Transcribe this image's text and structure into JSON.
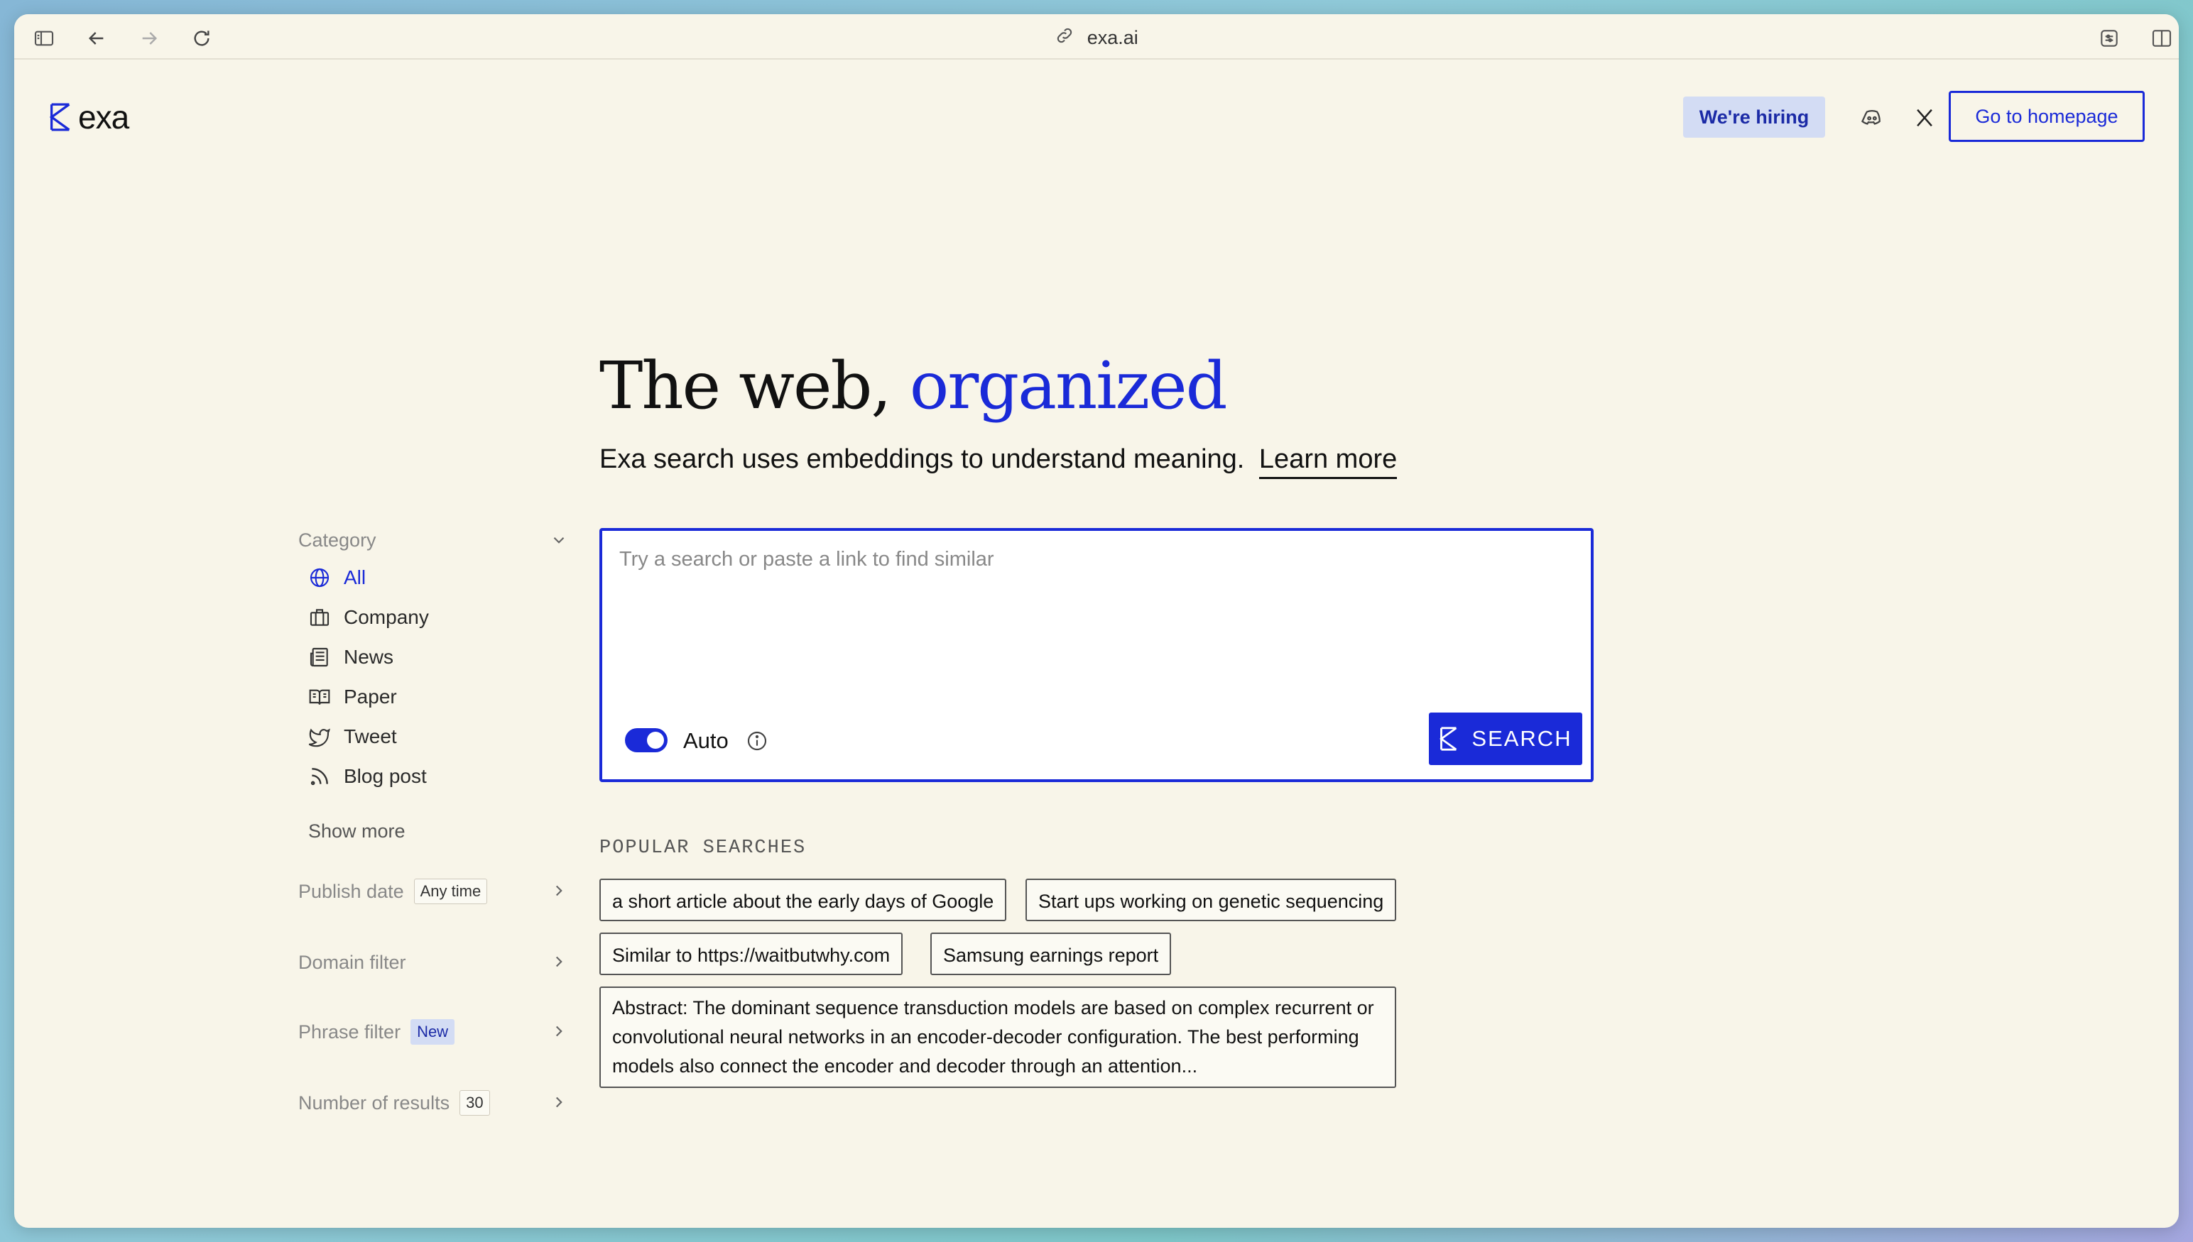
{
  "browser": {
    "url": "exa.ai"
  },
  "header": {
    "brand": "exa",
    "hiring_label": "We're hiring",
    "homepage_label": "Go to homepage"
  },
  "hero": {
    "title_plain": "The web,",
    "title_accent": "organized",
    "subtitle": "Exa search uses embeddings to understand meaning.",
    "learn_more": "Learn more"
  },
  "sidebar": {
    "category_label": "Category",
    "categories": [
      {
        "label": "All",
        "icon": "globe-icon",
        "active": true
      },
      {
        "label": "Company",
        "icon": "briefcase-icon"
      },
      {
        "label": "News",
        "icon": "newspaper-icon"
      },
      {
        "label": "Paper",
        "icon": "book-icon"
      },
      {
        "label": "Tweet",
        "icon": "twitter-icon"
      },
      {
        "label": "Blog post",
        "icon": "rss-icon"
      }
    ],
    "show_more": "Show more",
    "filters": [
      {
        "label": "Publish date",
        "badge": "Any time"
      },
      {
        "label": "Domain filter"
      },
      {
        "label": "Phrase filter",
        "badge": "New"
      },
      {
        "label": "Number of results",
        "badge": "30"
      }
    ]
  },
  "search": {
    "placeholder": "Try a search or paste a link to find similar",
    "auto_label": "Auto",
    "auto_enabled": true,
    "button_label": "SEARCH"
  },
  "popular": {
    "title": "POPULAR SEARCHES",
    "items": [
      "a short article about the early days of Google",
      "Start ups working on genetic sequencing",
      "Similar to https://waitbutwhy.com",
      "Samsung earnings report",
      "Abstract: The dominant sequence transduction models are based on complex recurrent or convolutional neural networks in an encoder-decoder configuration. The best performing models also connect the encoder and decoder through an attention..."
    ]
  },
  "colors": {
    "accent": "#1a2ad8",
    "background": "#f8f5e9",
    "hiring_bg": "#d3dcf4"
  }
}
